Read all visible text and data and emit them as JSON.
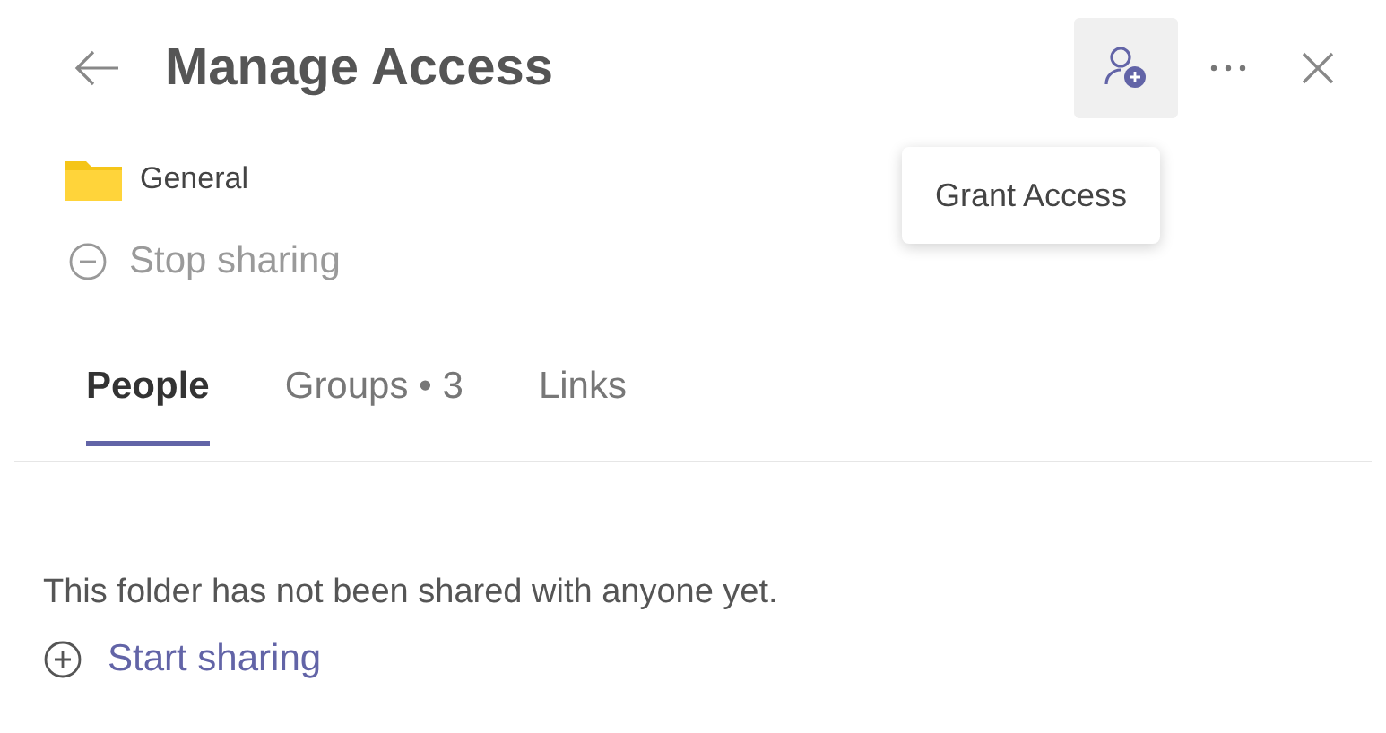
{
  "header": {
    "title": "Manage Access",
    "grant_button": {
      "hovered": true,
      "tooltip": "Grant Access"
    }
  },
  "folder": {
    "name": "General"
  },
  "stop_sharing": {
    "label": "Stop sharing",
    "disabled": true
  },
  "tabs": [
    {
      "label": "People",
      "selected": true
    },
    {
      "label": "Groups • 3",
      "selected": false
    },
    {
      "label": "Links",
      "selected": false
    }
  ],
  "empty_message": "This folder has not been shared with anyone yet.",
  "start_sharing": {
    "label": "Start sharing"
  }
}
